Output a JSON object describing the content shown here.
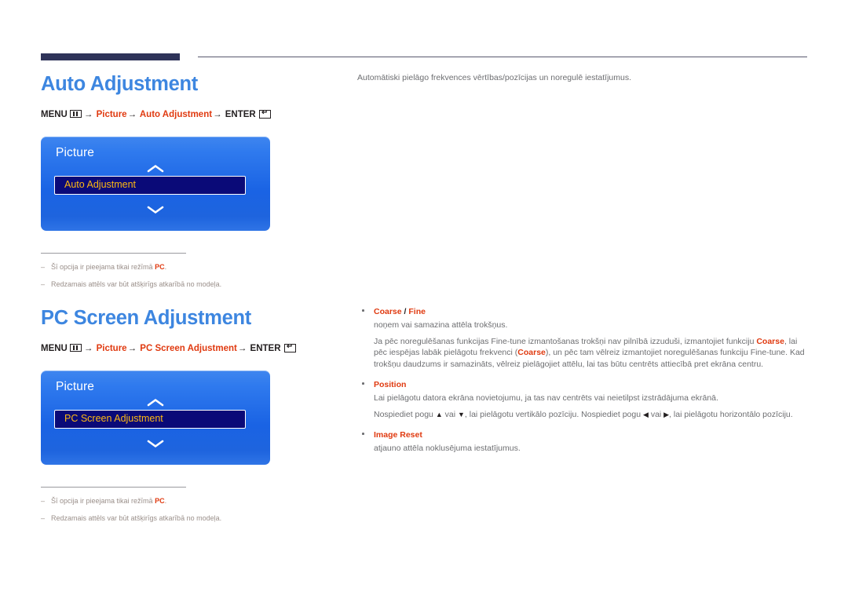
{
  "document": {
    "language": "lv"
  },
  "sections": [
    {
      "id": "auto-adjustment",
      "heading": "Auto Adjustment",
      "path": {
        "menu_label": "MENU",
        "menu_icon": "menu-grid-icon",
        "step1": "Picture",
        "step2": "Auto Adjustment",
        "enter_label": "ENTER",
        "enter_icon": "enter-return-icon",
        "arrow": "→"
      },
      "osd": {
        "title": "Picture",
        "chevron_up_icon": "chevron-up-icon",
        "chevron_down_icon": "chevron-down-icon",
        "selected_item": "Auto Adjustment"
      },
      "notes": [
        {
          "marker": "–",
          "text_before": "Šī opcija ir pieejama tikai režīmā ",
          "highlight": "PC",
          "text_after": "."
        },
        {
          "marker": "–",
          "text_before": "Redzamais attēls var būt atšķirīgs atkarībā no modeļa.",
          "highlight": "",
          "text_after": ""
        }
      ],
      "description": "Automātiski pielāgo frekvences vērtības/pozīcijas un noregulē iestatījumus."
    },
    {
      "id": "pc-screen-adjustment",
      "heading": "PC Screen Adjustment",
      "path": {
        "menu_label": "MENU",
        "menu_icon": "menu-grid-icon",
        "step1": "Picture",
        "step2": "PC Screen Adjustment",
        "enter_label": "ENTER",
        "enter_icon": "enter-return-icon",
        "arrow": "→"
      },
      "osd": {
        "title": "Picture",
        "chevron_up_icon": "chevron-up-icon",
        "chevron_down_icon": "chevron-down-icon",
        "selected_item": "PC Screen Adjustment"
      },
      "notes": [
        {
          "marker": "–",
          "text_before": "Šī opcija ir pieejama tikai režīmā ",
          "highlight": "PC",
          "text_after": "."
        },
        {
          "marker": "–",
          "text_before": "Redzamais attēls var būt atšķirīgs atkarībā no modeļa.",
          "highlight": "",
          "text_after": ""
        }
      ],
      "bullets": [
        {
          "title_main": "Coarse",
          "title_sep": " / ",
          "title_second": "Fine",
          "paragraphs": [
            "noņem vai samazina attēla trokšņus.",
            "Ja pēc noregulēšanas funkcijas Fine-tune izmantošanas trokšņi nav pilnībā izzuduši, izmantojiet funkciju Coarse, lai pēc iespējas labāk pielāgotu frekvenci (Coarse), un pēc tam vēlreiz izmantojiet noregulēšanas funkciju Fine-tune. Kad trokšņu daudzums ir samazināts, vēlreiz pielāgojiet attēlu, lai tas būtu centrēts attiecībā pret ekrāna centru."
          ]
        },
        {
          "title_main": "Position",
          "title_sep": "",
          "title_second": "",
          "paragraphs": [
            "Lai pielāgotu datora ekrāna novietojumu, ja tas nav centrēts vai neietilpst izstrādājuma ekrānā.",
            "Nospiediet pogu ▲ vai ▼, lai pielāgotu vertikālo pozīciju. Nospiediet pogu ◀ vai ▶, lai pielāgotu horizontālo pozīciju."
          ]
        },
        {
          "title_main": "Image Reset",
          "title_sep": "",
          "title_second": "",
          "paragraphs": [
            "atjauno attēla noklusējuma iestatījumus."
          ]
        }
      ]
    }
  ],
  "colors": {
    "heading_blue": "#3d86e0",
    "accent_red": "#e03a10",
    "rule_navy": "#2e3359",
    "osd_blue_top": "#3f86ef",
    "osd_blue_bottom": "#1e64de",
    "osd_selected_bg": "#0a0a78",
    "osd_selected_text": "#fdb813",
    "body_gray": "#6d6e71",
    "note_gray": "#9a8f8a"
  }
}
